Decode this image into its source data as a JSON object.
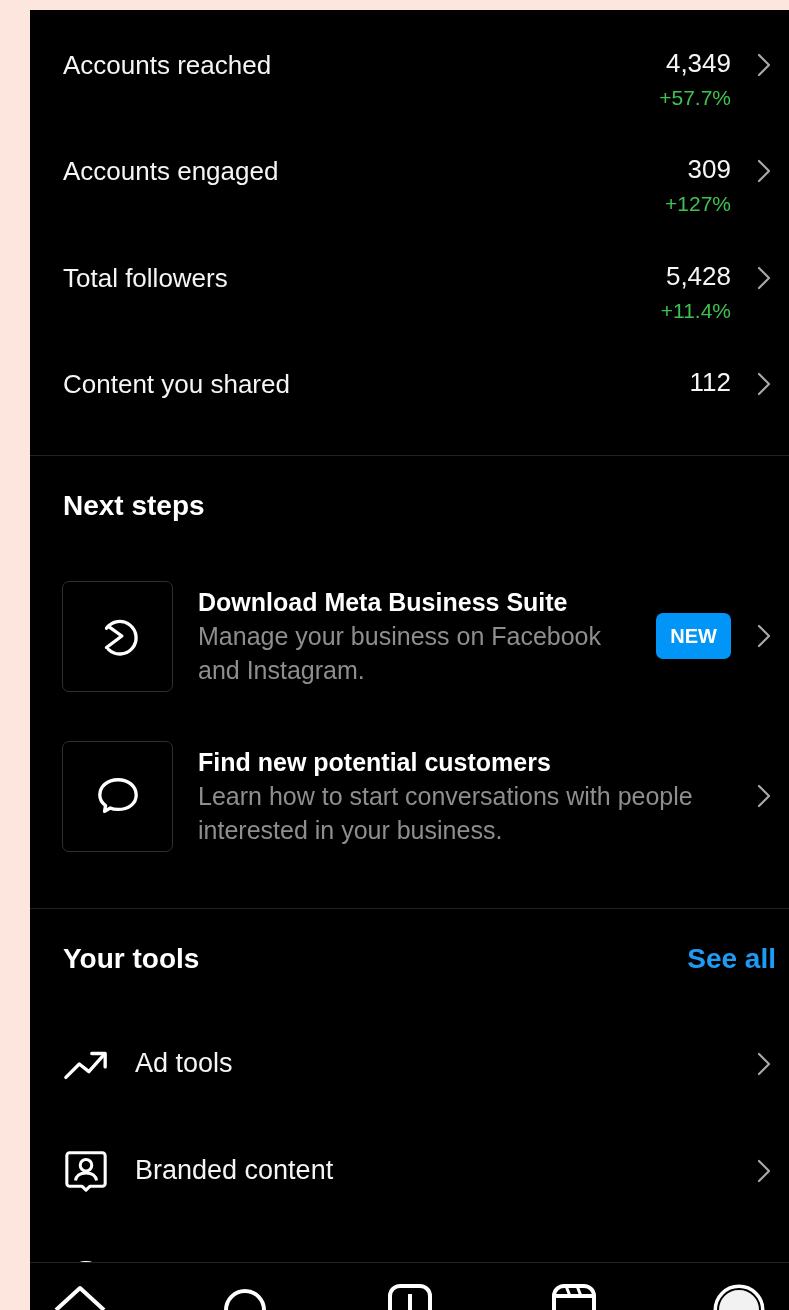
{
  "metrics": [
    {
      "label": "Accounts reached",
      "value": "4,349",
      "change": "+57.7%"
    },
    {
      "label": "Accounts engaged",
      "value": "309",
      "change": "+127%"
    },
    {
      "label": "Total followers",
      "value": "5,428",
      "change": "+11.4%"
    },
    {
      "label": "Content you shared",
      "value": "112"
    }
  ],
  "next_steps": {
    "title": "Next steps",
    "items": [
      {
        "title": "Download Meta Business Suite",
        "description": "Manage your business on Facebook and Instagram.",
        "badge": "NEW"
      },
      {
        "title": "Find new potential customers",
        "description": "Learn how to start conversations with people interested in your business."
      }
    ]
  },
  "tools": {
    "title": "Your tools",
    "action": "See all",
    "items": [
      {
        "label": "Ad tools"
      },
      {
        "label": "Branded content"
      }
    ]
  }
}
